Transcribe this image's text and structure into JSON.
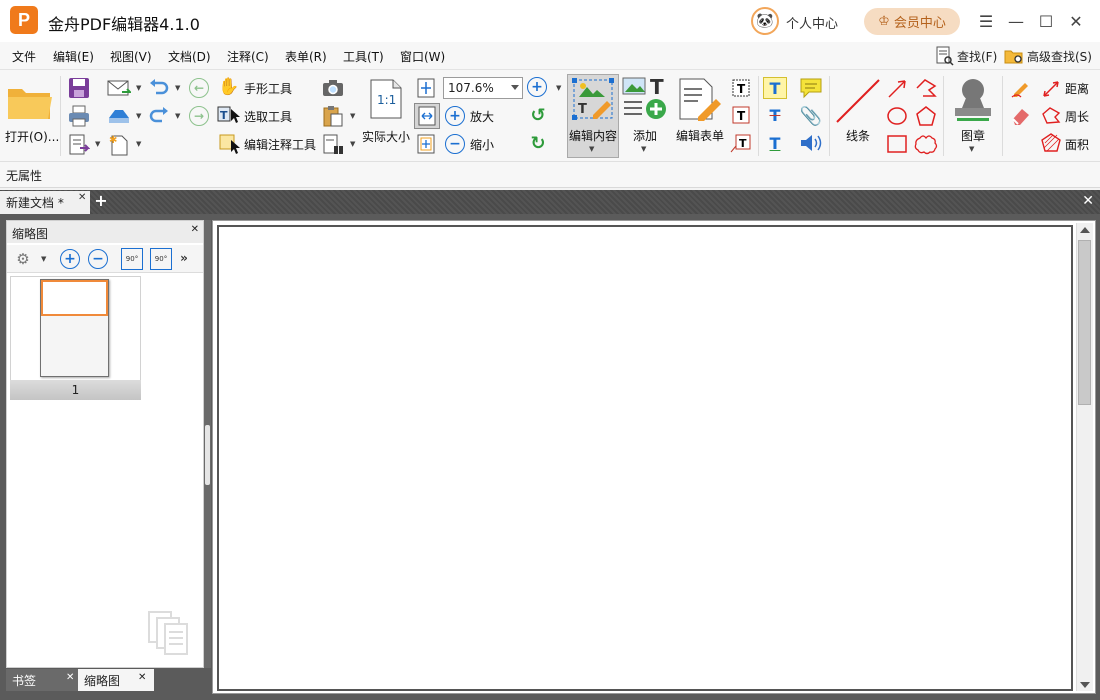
{
  "app": {
    "logo_letter": "P",
    "title": "金舟PDF编辑器4.1.0",
    "user_center": "个人中心",
    "vip_center": "会员中心",
    "window": {
      "menu_icon": "☰",
      "minimize_icon": "—",
      "maximize_icon": "☐",
      "close_icon": "✕"
    }
  },
  "menu": {
    "items": [
      "文件",
      "编辑(E)",
      "视图(V)",
      "文档(D)",
      "注释(C)",
      "表单(R)",
      "工具(T)",
      "窗口(W)"
    ],
    "find": "查找(F)",
    "advanced_find": "高级查找(S)"
  },
  "toolbar": {
    "open": "打开(O)...",
    "hand_tool": "手形工具",
    "select_tool": "选取工具",
    "edit_annotation_tool": "编辑注释工具",
    "actual_size": "实际大小",
    "zoom_value": "107.6%",
    "zoom_in": "放大",
    "zoom_out": "缩小",
    "edit_content": "编辑内容",
    "add": "添加",
    "edit_form": "编辑表单",
    "lines": "线条",
    "stamp": "图章",
    "distance": "距离",
    "perimeter": "周长",
    "area": "面积",
    "one_to_one": "1:1"
  },
  "properties": {
    "label": "无属性"
  },
  "tabs": {
    "document": "新建文档 *"
  },
  "left_panel": {
    "title": "缩略图",
    "page_number": "1",
    "rotate_label": "90°",
    "bottom_tabs": [
      "书签",
      "缩略图"
    ]
  },
  "colors": {
    "accent_orange": "#f07a1b",
    "vip_bg": "#f6dcc2",
    "icon_blue": "#1b6fd1",
    "tab_dark": "#4a4a4a"
  }
}
